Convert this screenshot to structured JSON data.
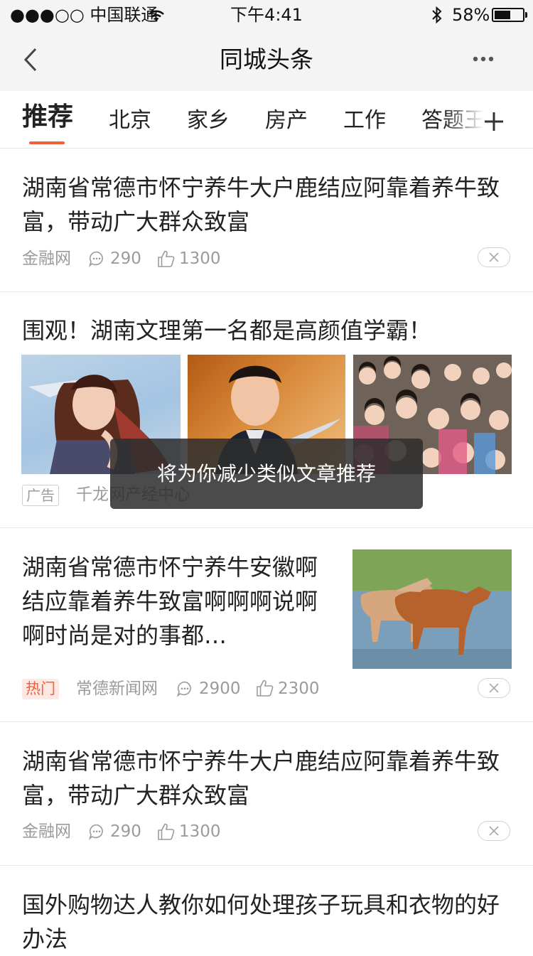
{
  "status_bar": {
    "carrier": "●●●○○ 中国联通",
    "time": "下午4:41",
    "battery": "58%",
    "battery_level": 0.58
  },
  "nav": {
    "title": "同城头条",
    "back_icon": "chevron-left-icon",
    "more_icon": "more-dots-icon"
  },
  "tabs": [
    {
      "label": "推荐",
      "active": true
    },
    {
      "label": "北京"
    },
    {
      "label": "家乡"
    },
    {
      "label": "房产"
    },
    {
      "label": "工作"
    },
    {
      "label": "答题王"
    }
  ],
  "tabs_add_icon": "plus-icon",
  "feed": [
    {
      "title": "湖南省常德市怀宁养牛大户鹿结应阿靠着养牛致富，带动广大群众致富",
      "source": "金融网",
      "comments": "290",
      "likes": "1300"
    },
    {
      "title": "围观！湖南文理第一名都是高颜值学霸！",
      "badge": "广告",
      "source": "千龙网产经中心"
    },
    {
      "title": "湖南省常德市怀宁养牛安徽啊结应靠着养牛致富啊啊啊说啊啊时尚是对的事都…",
      "badge": "热门",
      "source": "常德新闻网",
      "comments": "2900",
      "likes": "2300"
    },
    {
      "title": "湖南省常德市怀宁养牛大户鹿结应阿靠着养牛致富，带动广大群众致富",
      "source": "金融网",
      "comments": "290",
      "likes": "1300"
    },
    {
      "title": "国外购物达人教你如何处理孩子玩具和衣物的好办法"
    }
  ],
  "toast": "将为你减少类似文章推荐",
  "colors": {
    "accent": "#f25f3a",
    "hot_badge_bg": "#fde8e2",
    "hot_badge_text": "#f25f3a",
    "ad_badge_border": "#cfcfcf"
  }
}
